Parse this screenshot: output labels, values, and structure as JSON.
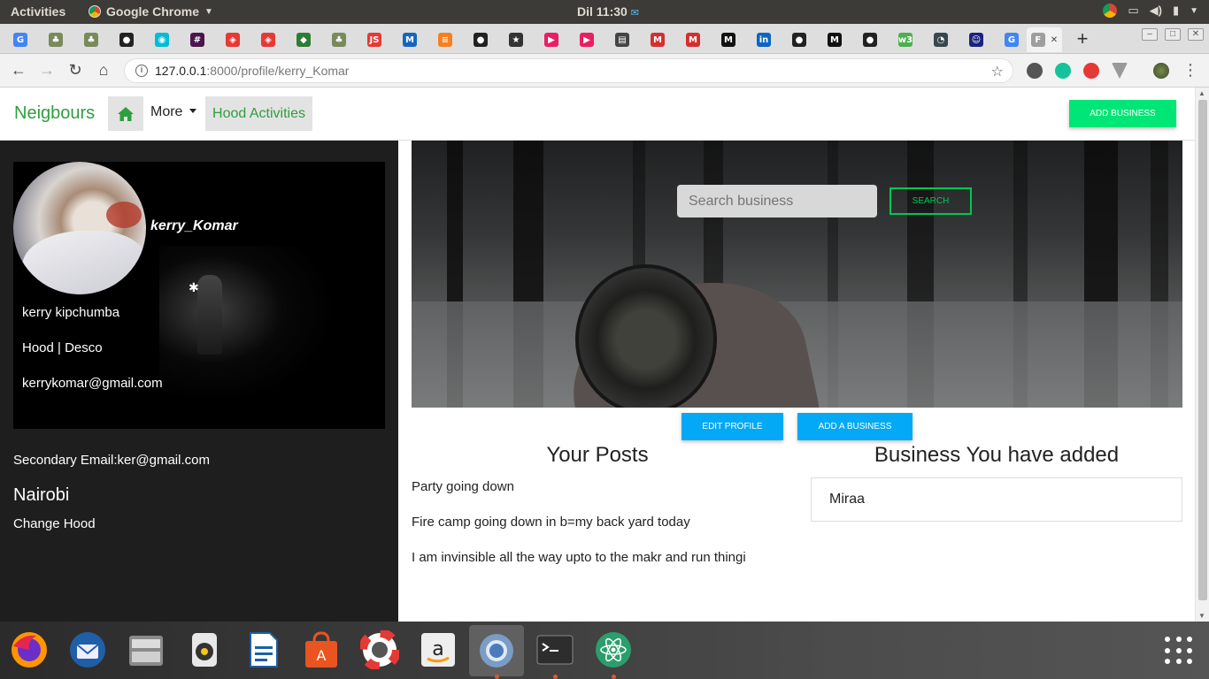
{
  "system_bar": {
    "activities": "Activities",
    "app_name": "Google Chrome",
    "clock": "Dil 11:30"
  },
  "tabs": [
    {
      "icon": "google-g-icon",
      "color": "#4285f4",
      "glyph": "G"
    },
    {
      "icon": "palm-tree-icon",
      "color": "#7a8a5a",
      "glyph": "♣"
    },
    {
      "icon": "palm-tree-icon",
      "color": "#7a8a5a",
      "glyph": "♣"
    },
    {
      "icon": "github-icon",
      "color": "#222222",
      "glyph": "●"
    },
    {
      "icon": "colorful-circle-icon",
      "color": "#00bcd4",
      "glyph": "◉"
    },
    {
      "icon": "slack-icon",
      "color": "#4a154b",
      "glyph": "#"
    },
    {
      "icon": "codepen-icon",
      "color": "#e53935",
      "glyph": "◈"
    },
    {
      "icon": "codepen-icon",
      "color": "#e53935",
      "glyph": "◈"
    },
    {
      "icon": "diamond-icon",
      "color": "#2e7d32",
      "glyph": "◆"
    },
    {
      "icon": "palm-tree-icon",
      "color": "#7a8a5a",
      "glyph": "♣"
    },
    {
      "icon": "js-icon",
      "color": "#e53935",
      "glyph": "JS"
    },
    {
      "icon": "mdb-icon",
      "color": "#1565c0",
      "glyph": "M"
    },
    {
      "icon": "stack-overflow-icon",
      "color": "#f48024",
      "glyph": "≡"
    },
    {
      "icon": "github-icon",
      "color": "#222222",
      "glyph": "●"
    },
    {
      "icon": "star-icon",
      "color": "#333333",
      "glyph": "★"
    },
    {
      "icon": "play-icon",
      "color": "#e91e63",
      "glyph": "▶"
    },
    {
      "icon": "play-icon",
      "color": "#e91e63",
      "glyph": "▶"
    },
    {
      "icon": "book-icon",
      "color": "#444444",
      "glyph": "▤"
    },
    {
      "icon": "gmail-icon",
      "color": "#d32f2f",
      "glyph": "M"
    },
    {
      "icon": "gmail-icon",
      "color": "#d32f2f",
      "glyph": "M"
    },
    {
      "icon": "medium-icon",
      "color": "#111111",
      "glyph": "M"
    },
    {
      "icon": "linkedin-icon",
      "color": "#0a66c2",
      "glyph": "in"
    },
    {
      "icon": "github-icon",
      "color": "#222222",
      "glyph": "●"
    },
    {
      "icon": "medium-icon",
      "color": "#111111",
      "glyph": "M"
    },
    {
      "icon": "github-icon",
      "color": "#222222",
      "glyph": "●"
    },
    {
      "icon": "w3-icon",
      "color": "#4caf50",
      "glyph": "w3"
    },
    {
      "icon": "circle-arrow-icon",
      "color": "#37474f",
      "glyph": "◔"
    },
    {
      "icon": "user-circle-icon",
      "color": "#1a237e",
      "glyph": "☺"
    },
    {
      "icon": "google-g-icon",
      "color": "#4285f4",
      "glyph": "G"
    },
    {
      "icon": "page-icon",
      "color": "#9e9e9e",
      "glyph": "F"
    }
  ],
  "tab_controls": {
    "new_tab": "+"
  },
  "address_bar": {
    "url_host": "127.0.0.1",
    "url_path": ":8000/profile/kerry_Komar"
  },
  "site": {
    "brand": "Neigbours",
    "nav_more": "More",
    "nav_hood": "Hood Activities",
    "add_business": "ADD BUSINESS"
  },
  "profile": {
    "username": "kerry_Komar",
    "full_name": "kerry kipchumba",
    "hood": "Hood | Desco",
    "email": "kerrykomar@gmail.com",
    "secondary_email": "Secondary Email:ker@gmail.com",
    "city": "Nairobi",
    "change_hood": "Change Hood"
  },
  "hero": {
    "search_placeholder": "Search business",
    "search_button": "SEARCH"
  },
  "actions": {
    "edit_profile": "EDIT PROFILE",
    "add_a_business": "ADD A BUSINESS"
  },
  "posts": {
    "heading": "Your Posts",
    "items": [
      "Party going down",
      "Fire camp going down in b=my back yard today",
      "I am invinsible all the way upto to the makr and run thingi"
    ]
  },
  "businesses": {
    "heading": "Business You have added",
    "items": [
      "Miraa"
    ]
  },
  "dock": [
    "firefox-icon",
    "thunderbird-icon",
    "files-icon",
    "rhythmbox-icon",
    "writer-icon",
    "software-center-icon",
    "help-icon",
    "amazon-icon",
    "chrome-icon",
    "terminal-icon",
    "atom-icon"
  ]
}
